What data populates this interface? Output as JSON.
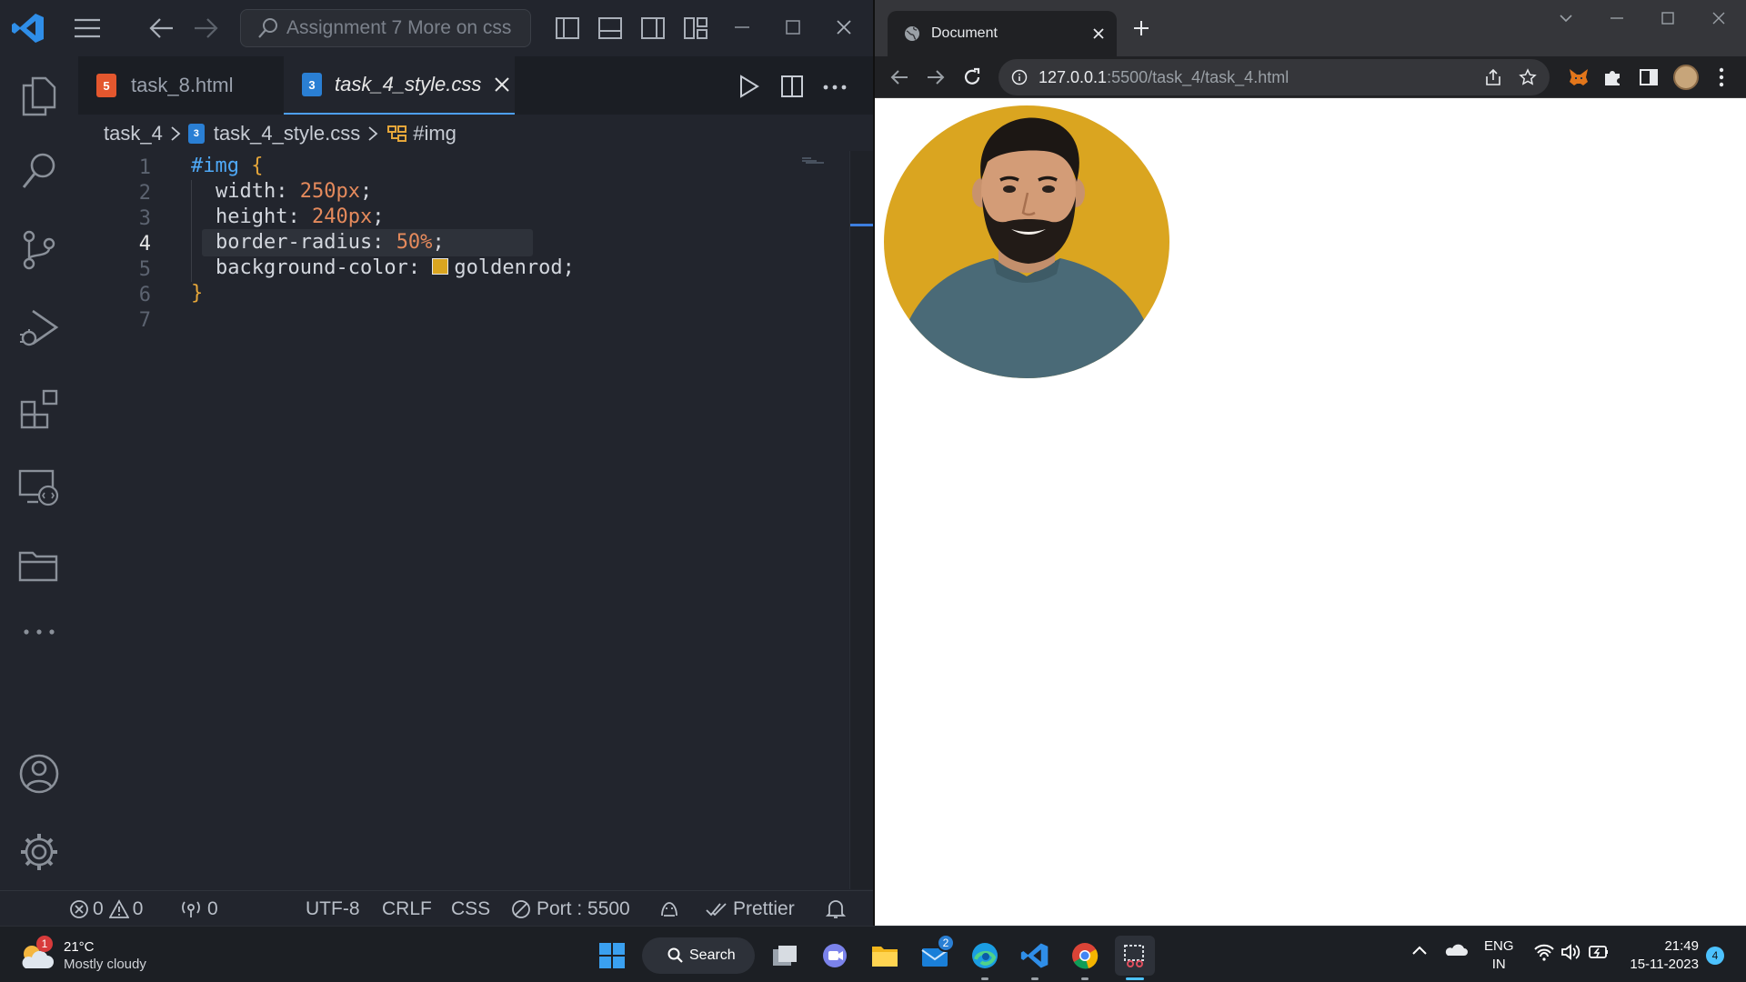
{
  "vscode": {
    "search_placeholder": "Assignment 7 More on css",
    "tabs": [
      {
        "label": "task_8.html",
        "type": "html"
      },
      {
        "label": "task_4_style.css",
        "type": "css",
        "active": true
      }
    ],
    "breadcrumb": {
      "folder": "task_4",
      "file": "task_4_style.css",
      "symbol": "#img"
    },
    "line_numbers": [
      "1",
      "2",
      "3",
      "4",
      "5",
      "6",
      "7"
    ],
    "current_line": "4",
    "code": {
      "l1_selector": "#img",
      "l1_brace": "{",
      "l2_prop": "width:",
      "l2_value": "250px",
      "l2_end": ";",
      "l3_prop": "height:",
      "l3_value": "240px",
      "l3_end": ";",
      "l4_prop": "border-radius:",
      "l4_value": "50%",
      "l4_end": ";",
      "l5_prop": "background-color:",
      "l5_value": "goldenrod;",
      "l6_brace": "}"
    },
    "swatch_color": "#daa520",
    "status": {
      "errors": "0",
      "warnings": "0",
      "ports": "0",
      "encoding": "UTF-8",
      "eol": "CRLF",
      "language": "CSS",
      "port": "Port : 5500",
      "formatter": "Prettier"
    }
  },
  "browser": {
    "tab_title": "Document",
    "url_host": "127.0.0.1",
    "url_path": ":5500/task_4/task_4.html",
    "avatar_bg": "#daa520"
  },
  "taskbar": {
    "weather_temp": "21°C",
    "weather_desc": "Mostly cloudy",
    "weather_badge": "1",
    "search_label": "Search",
    "mail_badge": "2",
    "lang_top": "ENG",
    "lang_bottom": "IN",
    "time": "21:49",
    "date": "15-11-2023",
    "notif_count": "4"
  }
}
